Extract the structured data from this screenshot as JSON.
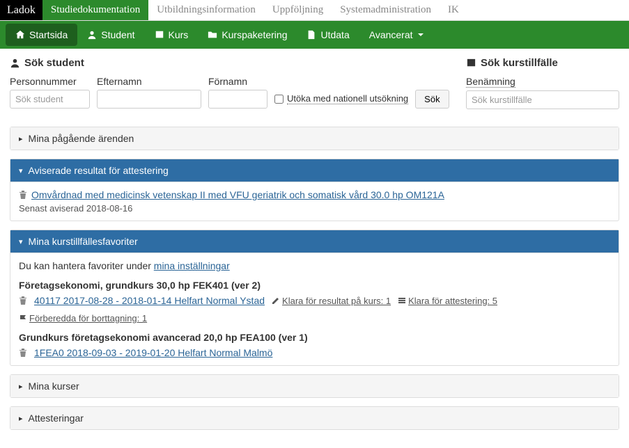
{
  "logo": "Ladok",
  "topTabs": [
    "Studiedokumentation",
    "Utbildningsinformation",
    "Uppföljning",
    "Systemadministration",
    "IK"
  ],
  "nav": {
    "startsida": "Startsida",
    "student": "Student",
    "kurs": "Kurs",
    "kurspaketering": "Kurspaketering",
    "utdata": "Utdata",
    "avancerat": "Avancerat"
  },
  "searchStudent": {
    "heading": "Sök student",
    "personnummer": {
      "label": "Personnummer",
      "placeholder": "Sök student"
    },
    "efternamn": {
      "label": "Efternamn"
    },
    "fornamn": {
      "label": "Förnamn"
    },
    "utoka": "Utöka med nationell utsökning",
    "sok": "Sök"
  },
  "searchKurs": {
    "heading": "Sök kurstillfälle",
    "benamning": {
      "label": "Benämning",
      "placeholder": "Sök kurstillfälle"
    }
  },
  "panels": {
    "pagaende": "Mina pågående ärenden",
    "aviserade": {
      "title": "Aviserade resultat för attestering",
      "itemLink": "Omvårdnad med medicinsk vetenskap II med VFU geriatrik och somatisk vård 30.0 hp OM121A",
      "senast": "Senast aviserad 2018-08-16"
    },
    "favoriter": {
      "title": "Mina kurstillfällesfavoriter",
      "intro1": "Du kan hantera favoriter under ",
      "introLink": "mina inställningar",
      "fav1": {
        "title": "Företagsekonomi, grundkurs 30,0 hp FEK401 (ver 2)",
        "link": "40117 2017-08-28 - 2018-01-14 Helfart Normal Ystad",
        "klaraResultat": "Klara för resultat på kurs: 1",
        "klaraAttestering": "Klara för attestering: 5",
        "forberedda": "Förberedda för borttagning: 1"
      },
      "fav2": {
        "title": "Grundkurs företagsekonomi avancerad 20,0 hp FEA100 (ver 1)",
        "link": "1FEA0 2018-09-03 - 2019-01-20 Helfart Normal Malmö"
      }
    },
    "minaKurser": "Mina kurser",
    "attesteringar": "Attesteringar"
  }
}
